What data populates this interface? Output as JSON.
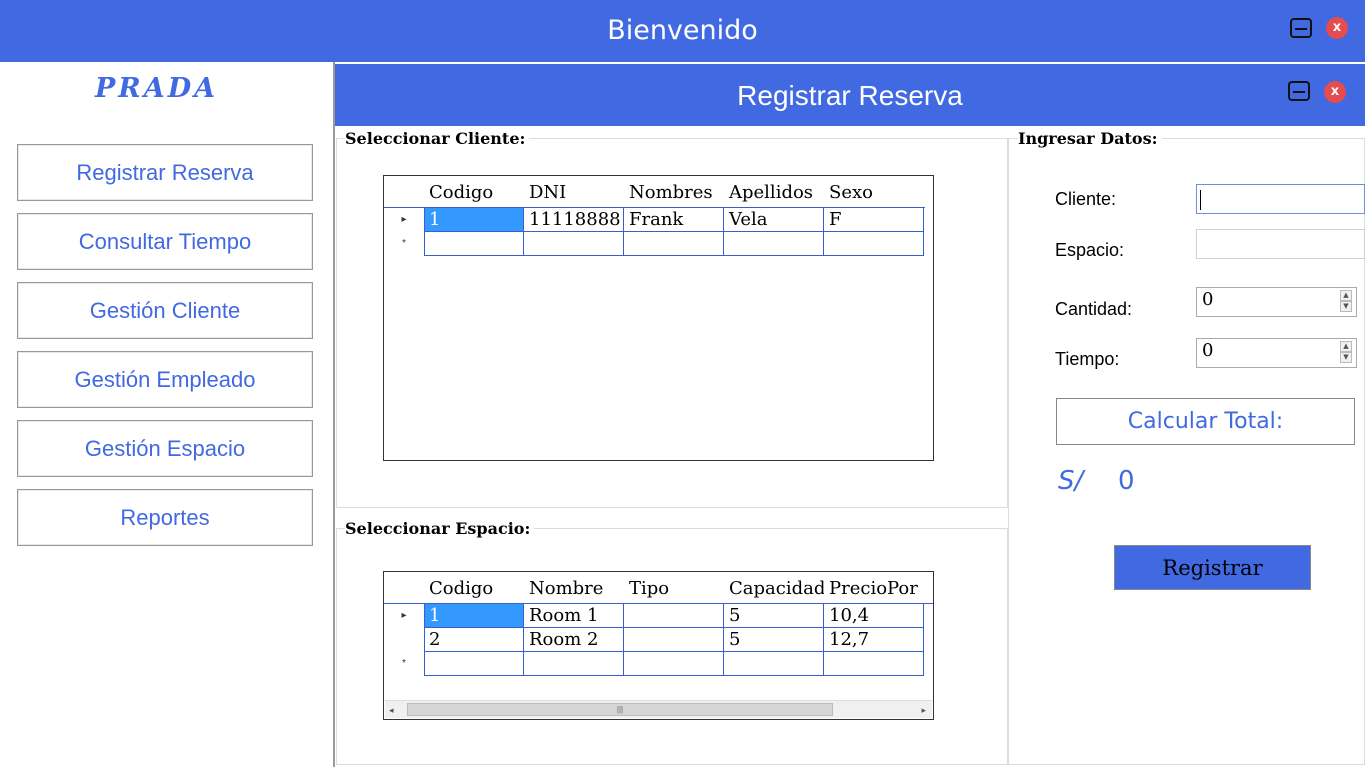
{
  "app": {
    "title": "Bienvenido",
    "minimize_icon": "minimize-icon",
    "close_icon": "close-icon",
    "close_glyph": "x"
  },
  "sidebar": {
    "logo": "PRADA",
    "items": [
      {
        "label": "Registrar Reserva"
      },
      {
        "label": "Consultar Tiempo"
      },
      {
        "label": "Gestión Cliente"
      },
      {
        "label": "Gestión Empleado"
      },
      {
        "label": "Gestión Espacio"
      },
      {
        "label": "Reportes"
      }
    ]
  },
  "window": {
    "title": "Registrar Reserva",
    "close_glyph": "x"
  },
  "cliente_section": {
    "label": "Seleccionar Cliente:",
    "columns": [
      "Codigo",
      "DNI",
      "Nombres",
      "Apellidos",
      "Sexo"
    ],
    "rows": [
      [
        "1",
        "11118888",
        "Frank",
        "Vela",
        "F"
      ]
    ]
  },
  "espacio_section": {
    "label": "Seleccionar Espacio:",
    "columns": [
      "Codigo",
      "Nombre",
      "Tipo",
      "Capacidad",
      "PrecioPor"
    ],
    "rows": [
      [
        "1",
        "Room 1",
        "",
        "5",
        "10,4"
      ],
      [
        "2",
        "Room 2",
        "",
        "5",
        "12,7"
      ]
    ]
  },
  "datos": {
    "label": "Ingresar Datos:",
    "cliente_label": "Cliente:",
    "cliente_value": "",
    "espacio_label": "Espacio:",
    "espacio_value": "",
    "cantidad_label": "Cantidad:",
    "cantidad_value": "0",
    "tiempo_label": "Tiempo:",
    "tiempo_value": "0",
    "calc_label": "Calcular Total:",
    "currency": "S/",
    "total": "0",
    "register_label": "Registrar"
  },
  "colors": {
    "accent": "#4169e1",
    "selection": "#3399ff",
    "close": "#e74c4c"
  }
}
